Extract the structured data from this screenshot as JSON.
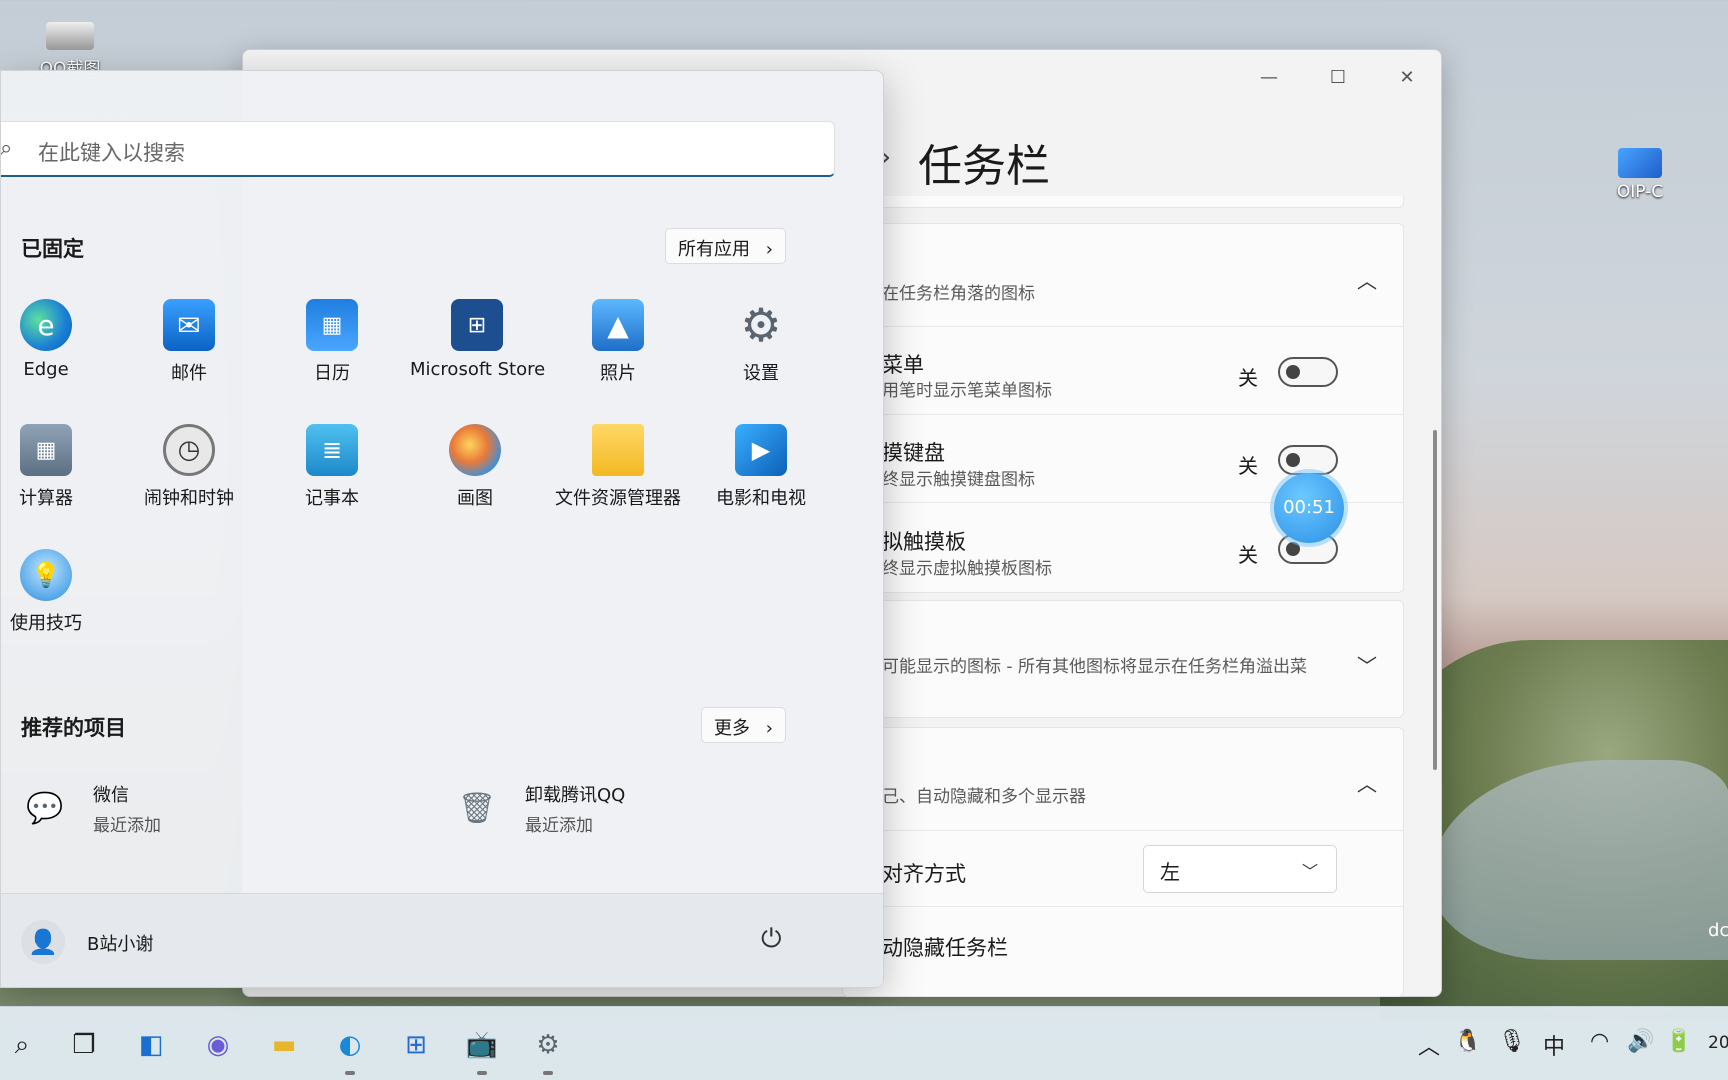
{
  "desktop": {
    "icons": [
      {
        "label": "QQ截图"
      },
      {
        "label": "OIP-C"
      }
    ],
    "right_edge_text": "dc"
  },
  "settings": {
    "title": "任务栏",
    "window_controls": {
      "minimize": "—",
      "maximize": "☐",
      "close": "✕"
    },
    "section_corner_icons": "在任务栏角落的图标",
    "rows": [
      {
        "title": "菜单",
        "subtitle": "用笔时显示笔菜单图标",
        "state": "关"
      },
      {
        "title": "摸键盘",
        "subtitle": "终显示触摸键盘图标",
        "state": "关"
      },
      {
        "title": "拟触摸板",
        "subtitle": "终显示虚拟触摸板图标",
        "state": "关"
      }
    ],
    "section_overflow": "可能显示的图标 - 所有其他图标将显示在任务栏角溢出菜",
    "section_behaviors": "己、自动隐藏和多个显示器",
    "alignment_label": "对齐方式",
    "alignment_value": "左",
    "autohide_label": "动隐藏任务栏",
    "timer": "00:51"
  },
  "start_menu": {
    "search_placeholder": "在此键入以搜索",
    "pinned_title": "已固定",
    "all_apps": "所有应用",
    "pinned_apps": [
      {
        "label": "Edge",
        "icon": "edge-icon"
      },
      {
        "label": "邮件",
        "icon": "mail-icon"
      },
      {
        "label": "日历",
        "icon": "calendar-icon"
      },
      {
        "label": "Microsoft Store",
        "icon": "store-icon"
      },
      {
        "label": "照片",
        "icon": "photos-icon"
      },
      {
        "label": "设置",
        "icon": "gear-icon"
      },
      {
        "label": "计算器",
        "icon": "calculator-icon"
      },
      {
        "label": "闹钟和时钟",
        "icon": "clock-icon"
      },
      {
        "label": "记事本",
        "icon": "notepad-icon"
      },
      {
        "label": "画图",
        "icon": "paint-icon"
      },
      {
        "label": "文件资源管理器",
        "icon": "folder-icon"
      },
      {
        "label": "电影和电视",
        "icon": "movies-icon"
      },
      {
        "label": "使用技巧",
        "icon": "tips-icon"
      }
    ],
    "recommended_title": "推荐的项目",
    "more": "更多",
    "recommended": [
      {
        "title": "微信",
        "subtitle": "最近添加",
        "icon": "wechat-icon"
      },
      {
        "title": "卸载腾讯QQ",
        "subtitle": "最近添加",
        "icon": "recycle-bin-icon"
      }
    ],
    "user": "B站小谢"
  },
  "taskbar": {
    "tray_ime": "中",
    "clock_partial": "20"
  }
}
